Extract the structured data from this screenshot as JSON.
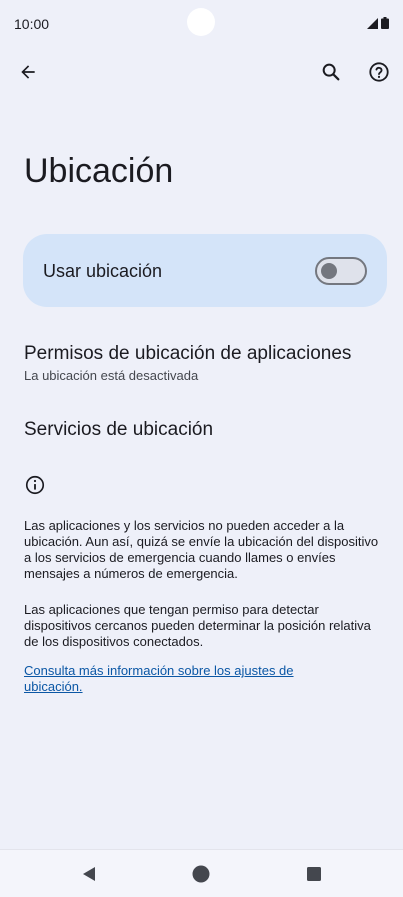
{
  "status_bar": {
    "time": "10:00"
  },
  "header": {
    "back_icon": "arrow-left-icon",
    "search_icon": "search-icon",
    "help_icon": "help-icon"
  },
  "page": {
    "title": "Ubicación",
    "main_toggle": {
      "label": "Usar ubicación",
      "on": false
    },
    "items": [
      {
        "title": "Permisos de ubicación de aplicaciones",
        "summary": "La ubicación está desactivada"
      },
      {
        "title": "Servicios de ubicación",
        "summary": ""
      }
    ],
    "footer": {
      "paragraph1": "Las aplicaciones y los servicios no pueden acceder a la ubicación. Aun así, quizá se envíe la ubicación del dispositivo a los servicios de emergencia cuando llames o envíes mensajes a números de emergencia.",
      "paragraph2": "Las aplicaciones que tengan permiso para detectar dispositivos cercanos pueden determinar la posición relativa de los dispositivos conectados.",
      "link": "Consulta más información sobre los ajustes de ubicación."
    }
  },
  "colors": {
    "background": "#eef0f9",
    "toggle_card": "#d4e4f9",
    "link": "#0b57a5"
  }
}
